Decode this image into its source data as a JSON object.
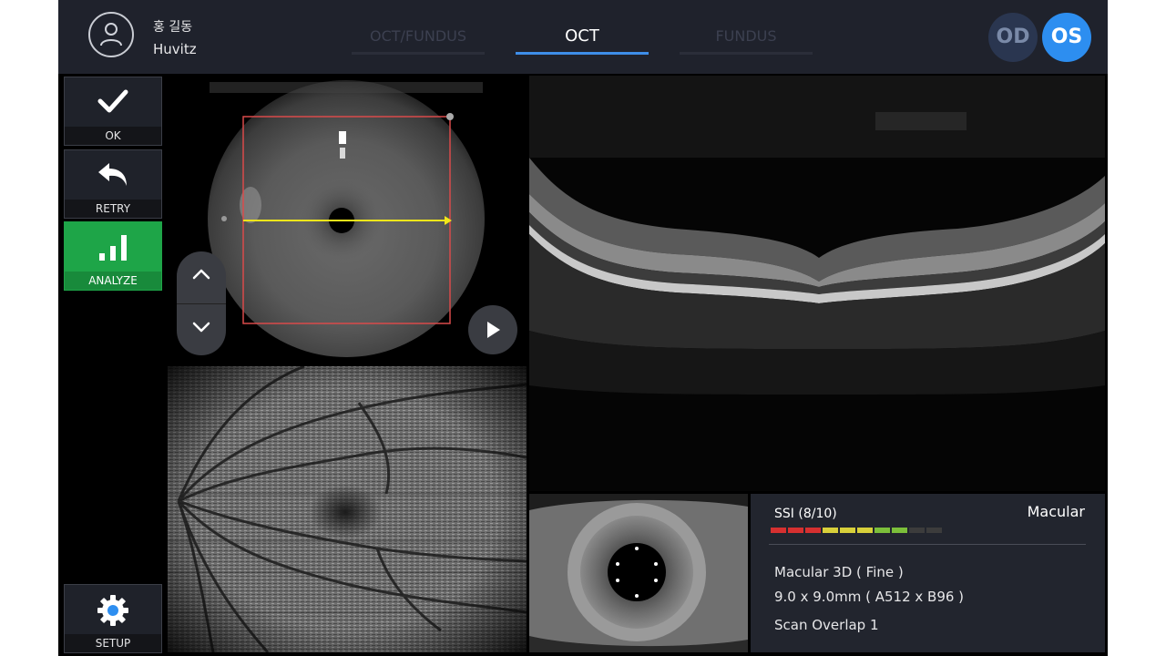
{
  "header": {
    "user_name": "홍 길동",
    "user_org": "Huvitz",
    "tabs": [
      {
        "label": "OCT/FUNDUS",
        "active": false
      },
      {
        "label": "OCT",
        "active": true
      },
      {
        "label": "FUNDUS",
        "active": false
      }
    ],
    "eye_od": "OD",
    "eye_os": "OS",
    "selected_eye": "OS",
    "accent_color": "#2d8ef0"
  },
  "sidebar": {
    "ok_label": "OK",
    "retry_label": "RETRY",
    "analyze_label": "ANALYZE",
    "setup_label": "SETUP",
    "analyze_color": "#1ea548"
  },
  "info": {
    "ssi_label": "SSI (8/10)",
    "ssi_value": 8,
    "ssi_max": 10,
    "ssi_colors": [
      "#d63030",
      "#d63030",
      "#d63030",
      "#d8d03a",
      "#d8d03a",
      "#d8d03a",
      "#7cbf3a",
      "#7cbf3a",
      "#3c3c3c",
      "#3c3c3c"
    ],
    "scan_type": "Macular",
    "protocol": "Macular 3D ( Fine )",
    "dimensions": "9.0 x 9.0mm ( A512 x B96 )",
    "overlap": "Scan Overlap 1"
  },
  "icons": {
    "ok": "check-icon",
    "retry": "undo-icon",
    "analyze": "bar-chart-icon",
    "setup": "gear-icon",
    "up": "chevron-up-icon",
    "down": "chevron-down-icon",
    "play": "play-icon"
  }
}
